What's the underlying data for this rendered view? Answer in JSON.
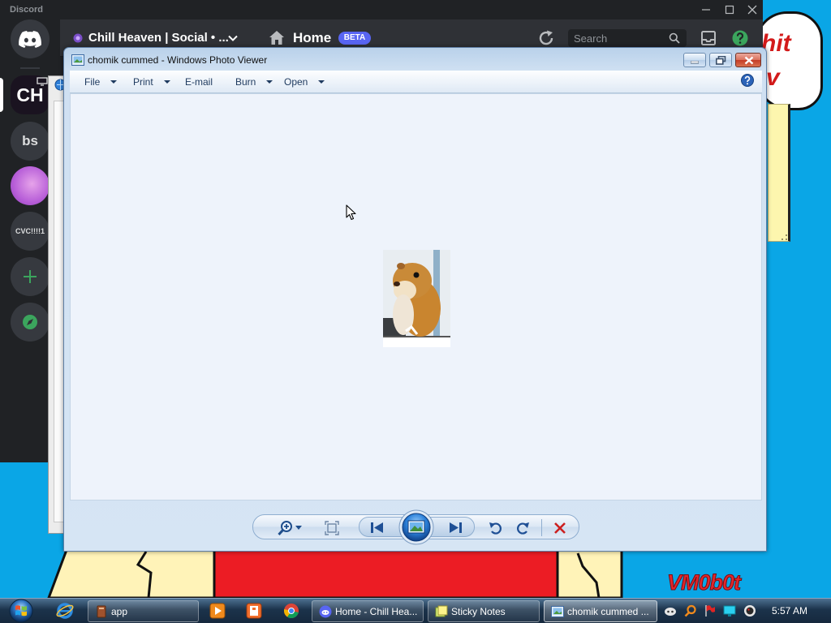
{
  "desktop": {
    "bubble_line_1": "hit",
    "bubble_line_2": "v",
    "watermark": "VM0b0t"
  },
  "discord": {
    "brand": "Discord",
    "server_title": "Chill Heaven | Social • ...",
    "home_label": "Home",
    "beta_badge": "BETA",
    "search_placeholder": "Search",
    "servers": [
      "CH",
      "bs",
      "CVC!!!!1"
    ]
  },
  "photo_viewer": {
    "title": "chomik cummed - Windows Photo Viewer",
    "menu": {
      "file": "File",
      "print": "Print",
      "email": "E-mail",
      "burn": "Burn",
      "open": "Open"
    },
    "controls": [
      "zoom-icon",
      "fit-to-window-icon",
      "previous-icon",
      "slideshow-icon",
      "next-icon",
      "rotate-counterclockwise-icon",
      "rotate-clockwise-icon",
      "delete-icon"
    ]
  },
  "taskbar": {
    "items": [
      {
        "label": "app",
        "icon": "app-icon"
      },
      {
        "label": "Home - Chill Hea...",
        "icon": "discord-icon"
      },
      {
        "label": "Sticky Notes",
        "icon": "sticky-notes-icon"
      },
      {
        "label": "chomik cummed ...",
        "icon": "photo-viewer-icon"
      }
    ],
    "pinned_icons": [
      "internet-explorer-icon",
      "media-player-icon",
      "archive-icon",
      "chrome-icon"
    ],
    "tray_icons": [
      "discord-tray-icon",
      "search-tray-icon",
      "flag-tray-icon",
      "display-tray-icon",
      "record-tray-icon"
    ],
    "clock": "5:57 AM"
  },
  "colors": {
    "desktop_background": "#0aa6e6",
    "discord_background": "#202225",
    "discord_header": "#2f3136",
    "beta_badge": "#5865f2",
    "photo_viewer_frame": "#cfe0f2",
    "photo_viewer_canvas": "#eef3fb",
    "art_red": "#ec1c24",
    "art_yellow": "#fff3b8",
    "delete_red": "#cc1f1f"
  }
}
